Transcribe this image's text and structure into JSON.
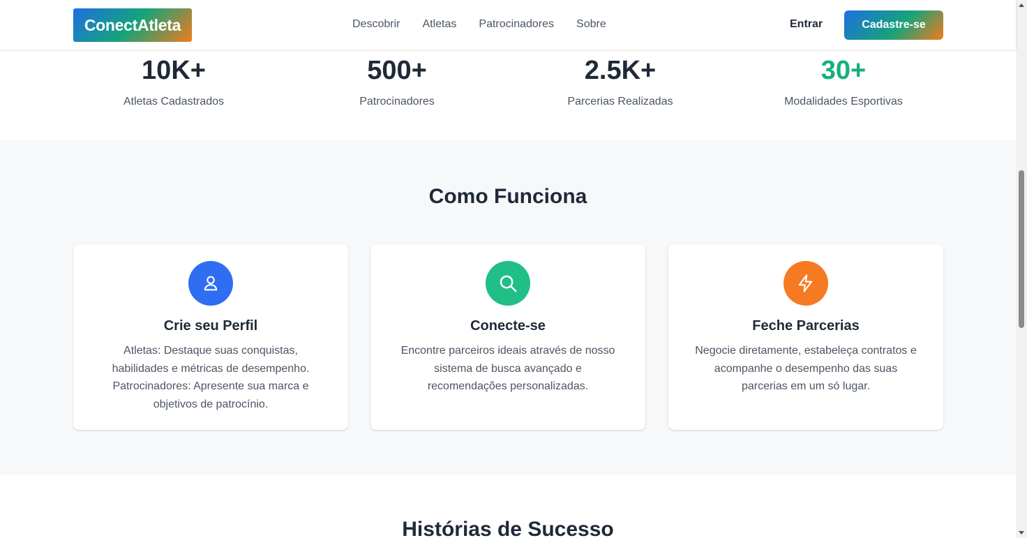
{
  "header": {
    "logo": "ConectAtleta",
    "nav": [
      "Descobrir",
      "Atletas",
      "Patrocinadores",
      "Sobre"
    ],
    "login_label": "Entrar",
    "signup_label": "Cadastre-se"
  },
  "stats": [
    {
      "value": "10K+",
      "label": "Atletas Cadastrados"
    },
    {
      "value": "500+",
      "label": "Patrocinadores"
    },
    {
      "value": "2.5K+",
      "label": "Parcerias Realizadas"
    },
    {
      "value": "30+",
      "label": "Modalidades Esportivas"
    }
  ],
  "how_it_works": {
    "title": "Como Funciona",
    "cards": [
      {
        "icon": "user-icon",
        "icon_color": "#2f6ef2",
        "title": "Crie seu Perfil",
        "text": "Atletas: Destaque suas conquistas, habilidades e métricas de desempenho. Patrocinadores: Apresente sua marca e objetivos de patrocínio."
      },
      {
        "icon": "search-icon",
        "icon_color": "#1fbf87",
        "title": "Conecte-se",
        "text": "Encontre parceiros ideais através de nosso sistema de busca avançado e recomendações personalizadas."
      },
      {
        "icon": "lightning-icon",
        "icon_color": "#f57a22",
        "title": "Feche Parcerias",
        "text": "Negocie diretamente, estabeleça contratos e acompanhe o desempenho das suas parcerias em um só lugar."
      }
    ]
  },
  "stories": {
    "title": "Histórias de Sucesso"
  },
  "colors": {
    "accent_green": "#16b07e",
    "blue": "#2f6ef2",
    "orange": "#f57a22"
  }
}
